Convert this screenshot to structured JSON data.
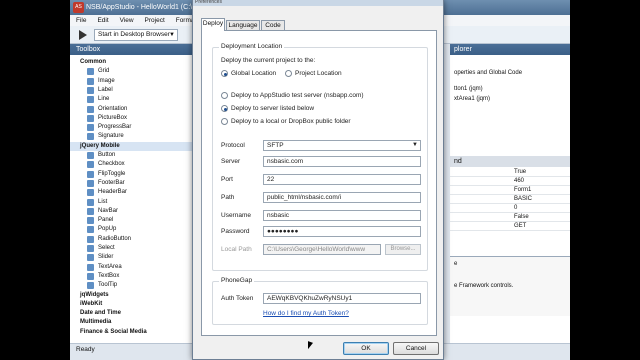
{
  "app": {
    "title": "NSB/AppStudio - HelloWorld1 (C:\\",
    "menu": [
      "File",
      "Edit",
      "View",
      "Project",
      "Format"
    ],
    "run_target": "Start in Desktop Browser",
    "toolbox_title": "Toolbox",
    "status": "Ready",
    "right_header": "plorer",
    "right_lines": [
      "operties and Global Code",
      "tton1 (jqm)",
      "xtArea1 (jqm)"
    ],
    "properties_header": "nd",
    "properties": [
      "True",
      "460",
      "Form1",
      "BASIC",
      "0",
      "False",
      "GET"
    ],
    "right_bottom": [
      "e",
      "e Framework controls."
    ]
  },
  "toolbox": {
    "rows": [
      {
        "type": "cat",
        "label": "Common"
      },
      {
        "type": "item",
        "label": "Grid"
      },
      {
        "type": "item",
        "label": "Image"
      },
      {
        "type": "item",
        "label": "Label"
      },
      {
        "type": "item",
        "label": "Line"
      },
      {
        "type": "item",
        "label": "Orientation"
      },
      {
        "type": "item",
        "label": "PictureBox"
      },
      {
        "type": "item",
        "label": "ProgressBar"
      },
      {
        "type": "item",
        "label": "Signature"
      },
      {
        "type": "cat",
        "label": "jQuery Mobile"
      },
      {
        "type": "item",
        "label": "Button"
      },
      {
        "type": "item",
        "label": "Checkbox"
      },
      {
        "type": "item",
        "label": "FlipToggle"
      },
      {
        "type": "item",
        "label": "FooterBar"
      },
      {
        "type": "item",
        "label": "HeaderBar"
      },
      {
        "type": "item",
        "label": "List"
      },
      {
        "type": "item",
        "label": "NavBar"
      },
      {
        "type": "item",
        "label": "Panel"
      },
      {
        "type": "item",
        "label": "PopUp"
      },
      {
        "type": "item",
        "label": "RadioButton"
      },
      {
        "type": "item",
        "label": "Select"
      },
      {
        "type": "item",
        "label": "Slider"
      },
      {
        "type": "item",
        "label": "TextArea"
      },
      {
        "type": "item",
        "label": "TextBox"
      },
      {
        "type": "item",
        "label": "ToolTip"
      },
      {
        "type": "cat",
        "label": "jqWidgets"
      },
      {
        "type": "cat",
        "label": "iWebKit"
      },
      {
        "type": "cat",
        "label": "Date and Time"
      },
      {
        "type": "cat",
        "label": "Multimedia"
      },
      {
        "type": "cat",
        "label": "Finance & Social Media"
      }
    ]
  },
  "dialog": {
    "title": "Preferences",
    "tabs": [
      "Deploy",
      "Language",
      "Code"
    ],
    "deployment_location": {
      "heading": "Deployment Location",
      "prompt": "Deploy the current project to the:",
      "scope_options": [
        "Global Location",
        "Project Location"
      ],
      "target_options": [
        "Deploy to AppStudio test server (nsbapp.com)",
        "Deploy to server listed below",
        "Deploy to a local or DropBox public folder"
      ]
    },
    "fields": {
      "protocol_label": "Protocol",
      "protocol_value": "SFTP",
      "server_label": "Server",
      "server_value": "nsbasic.com",
      "port_label": "Port",
      "port_value": "22",
      "path_label": "Path",
      "path_value": "public_html/nsbasic.com/i",
      "username_label": "Username",
      "username_value": "nsbasic",
      "password_label": "Password",
      "password_value": "●●●●●●●●",
      "localpath_label": "Local Path",
      "localpath_value": "C:\\Users\\George\\HelloWorld\\www",
      "browse_label": "Browse..."
    },
    "phonegap": {
      "heading": "PhoneGap",
      "auth_label": "Auth Token",
      "auth_value": "AEWqKBVQKhuZwRyNSUy1",
      "help_link": "How do I find my Auth Token?"
    },
    "ok_label": "OK",
    "cancel_label": "Cancel"
  }
}
